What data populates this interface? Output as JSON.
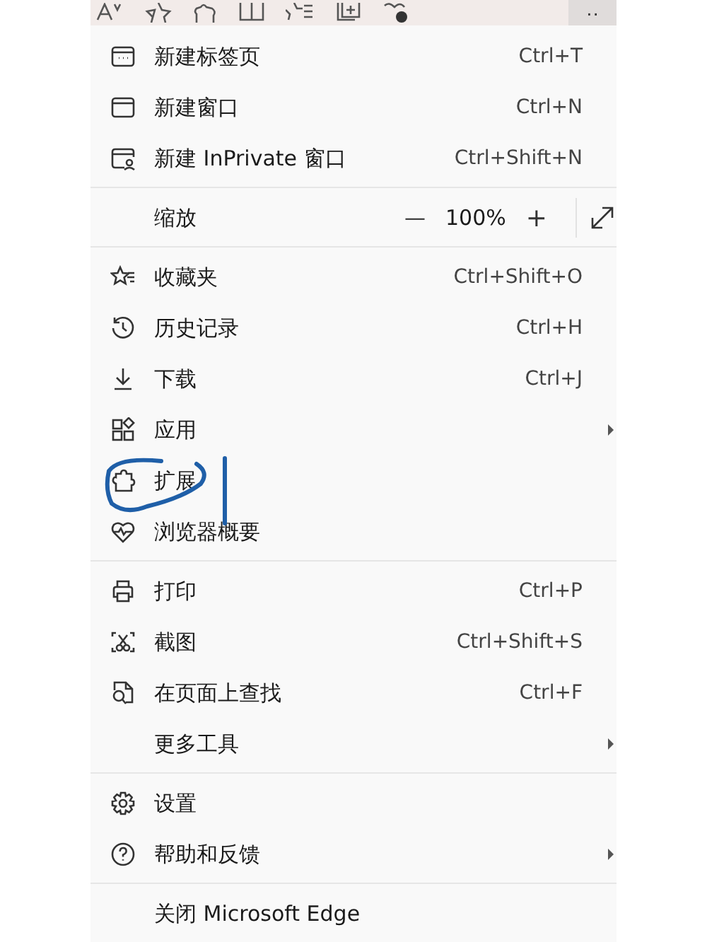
{
  "toolbar": {
    "more_button": {
      "label": "··",
      "selected": true
    }
  },
  "menu": [
    {
      "kind": "item",
      "label": "新建标签页",
      "shortcut": "Ctrl+T"
    },
    {
      "kind": "item",
      "label": "新建窗口",
      "shortcut": "Ctrl+N"
    },
    {
      "kind": "item",
      "label": "新建 InPrivate 窗口",
      "shortcut": "Ctrl+Shift+N"
    },
    {
      "kind": "separator"
    },
    {
      "kind": "zoom",
      "label": "缩放",
      "minus": "—",
      "value": "100%",
      "plus": "+"
    },
    {
      "kind": "separator"
    },
    {
      "kind": "item",
      "label": "收藏夹",
      "shortcut": "Ctrl+Shift+O"
    },
    {
      "kind": "item",
      "label": "历史记录",
      "shortcut": "Ctrl+H"
    },
    {
      "kind": "item",
      "label": "下载",
      "shortcut": "Ctrl+J"
    },
    {
      "kind": "item",
      "label": "应用",
      "submenu": true
    },
    {
      "kind": "item",
      "label": "扩展"
    },
    {
      "kind": "item",
      "label": "浏览器概要"
    },
    {
      "kind": "separator"
    },
    {
      "kind": "item",
      "label": "打印",
      "shortcut": "Ctrl+P"
    },
    {
      "kind": "item",
      "label": "截图",
      "shortcut": "Ctrl+Shift+S"
    },
    {
      "kind": "item",
      "label": "在页面上查找",
      "shortcut": "Ctrl+F"
    },
    {
      "kind": "item",
      "label": "更多工具",
      "submenu": true
    },
    {
      "kind": "separator"
    },
    {
      "kind": "item",
      "label": "设置"
    },
    {
      "kind": "item",
      "label": "帮助和反馈",
      "submenu": true
    },
    {
      "kind": "separator"
    },
    {
      "kind": "item",
      "label": "关闭 Microsoft Edge"
    }
  ]
}
